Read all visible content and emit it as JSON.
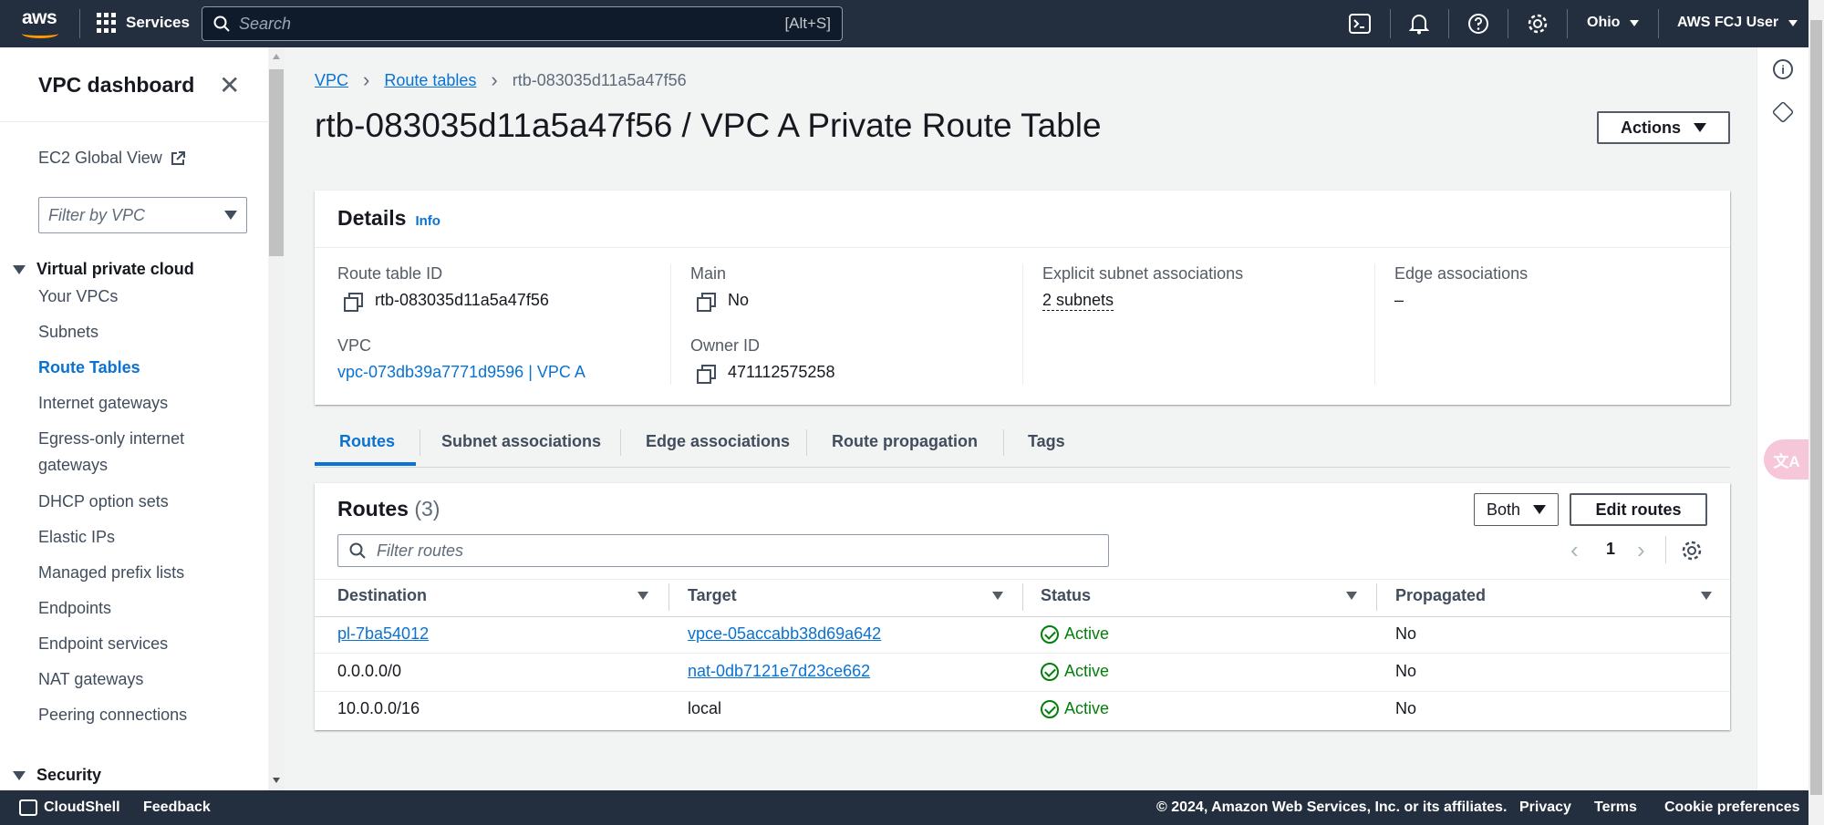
{
  "topnav": {
    "logo": "aws",
    "services": "Services",
    "search_placeholder": "Search",
    "search_shortcut": "[Alt+S]",
    "region": "Ohio",
    "user": "AWS FCJ User",
    "icons": [
      "cloudshell-icon",
      "bell-icon",
      "help-icon",
      "settings-icon"
    ]
  },
  "sidebar": {
    "title": "VPC dashboard",
    "global_view": "EC2 Global View",
    "filter_placeholder": "Filter by VPC",
    "section_vpc": "Virtual private cloud",
    "items": [
      {
        "label": "Your VPCs"
      },
      {
        "label": "Subnets"
      },
      {
        "label": "Route Tables"
      },
      {
        "label": "Internet gateways"
      },
      {
        "label": "Egress-only internet gateways"
      },
      {
        "label": "DHCP option sets"
      },
      {
        "label": "Elastic IPs"
      },
      {
        "label": "Managed prefix lists"
      },
      {
        "label": "Endpoints"
      },
      {
        "label": "Endpoint services"
      },
      {
        "label": "NAT gateways"
      },
      {
        "label": "Peering connections"
      }
    ],
    "active_item": "Route Tables",
    "section_security": "Security"
  },
  "breadcrumb": {
    "items": [
      "VPC",
      "Route tables"
    ],
    "current": "rtb-083035d11a5a47f56"
  },
  "page": {
    "title": "rtb-083035d11a5a47f56 / VPC A Private Route Table",
    "actions_label": "Actions"
  },
  "details": {
    "heading": "Details",
    "info": "Info",
    "route_table_id_label": "Route table ID",
    "route_table_id": "rtb-083035d11a5a47f56",
    "main_label": "Main",
    "main": "No",
    "explicit_label": "Explicit subnet associations",
    "explicit": "2 subnets",
    "edge_label": "Edge associations",
    "edge": "–",
    "vpc_label": "VPC",
    "vpc": "vpc-073db39a7771d9596 | VPC A",
    "owner_label": "Owner ID",
    "owner": "471112575258"
  },
  "tabs": [
    "Routes",
    "Subnet associations",
    "Edge associations",
    "Route propagation",
    "Tags"
  ],
  "routes": {
    "heading": "Routes",
    "count": "(3)",
    "filter_select": "Both",
    "edit_label": "Edit routes",
    "filter_placeholder": "Filter routes",
    "page": "1",
    "columns": [
      "Destination",
      "Target",
      "Status",
      "Propagated"
    ],
    "rows": [
      {
        "destination": "pl-7ba54012",
        "target": "vpce-05accabb38d69a642",
        "status": "Active",
        "propagated": "No"
      },
      {
        "destination": "0.0.0.0/0",
        "target": "nat-0db7121e7d23ce662",
        "status": "Active",
        "propagated": "No"
      },
      {
        "destination": "10.0.0.0/16",
        "target": "local",
        "status": "Active",
        "propagated": "No"
      }
    ]
  },
  "footer": {
    "cloudshell": "CloudShell",
    "feedback": "Feedback",
    "copyright": "© 2024, Amazon Web Services, Inc. or its affiliates.",
    "privacy": "Privacy",
    "terms": "Terms",
    "cookies": "Cookie preferences"
  },
  "colors": {
    "nav_bg": "#232f3e",
    "link": "#0972d3",
    "success": "#037f0c",
    "accent": "#ff9900"
  },
  "translate_badge": "文A"
}
